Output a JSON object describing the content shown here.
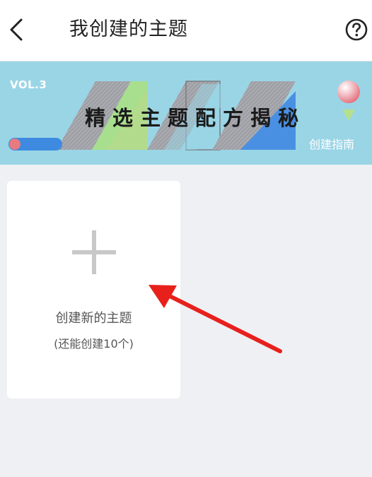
{
  "header": {
    "title": "我创建的主题",
    "back_icon": "chevron-left-icon",
    "help_icon": "question-circle-icon"
  },
  "banner": {
    "vol": "VOL.3",
    "title": "精选主题配方揭秘",
    "guide_label": "创建指南",
    "bg_color": "#9ad5e6"
  },
  "create_card": {
    "icon": "plus-icon",
    "label": "创建新的主题",
    "sub_label": "(还能创建10个)"
  },
  "colors": {
    "accent_arrow": "#e8201c",
    "page_bg": "#eef0f3"
  }
}
